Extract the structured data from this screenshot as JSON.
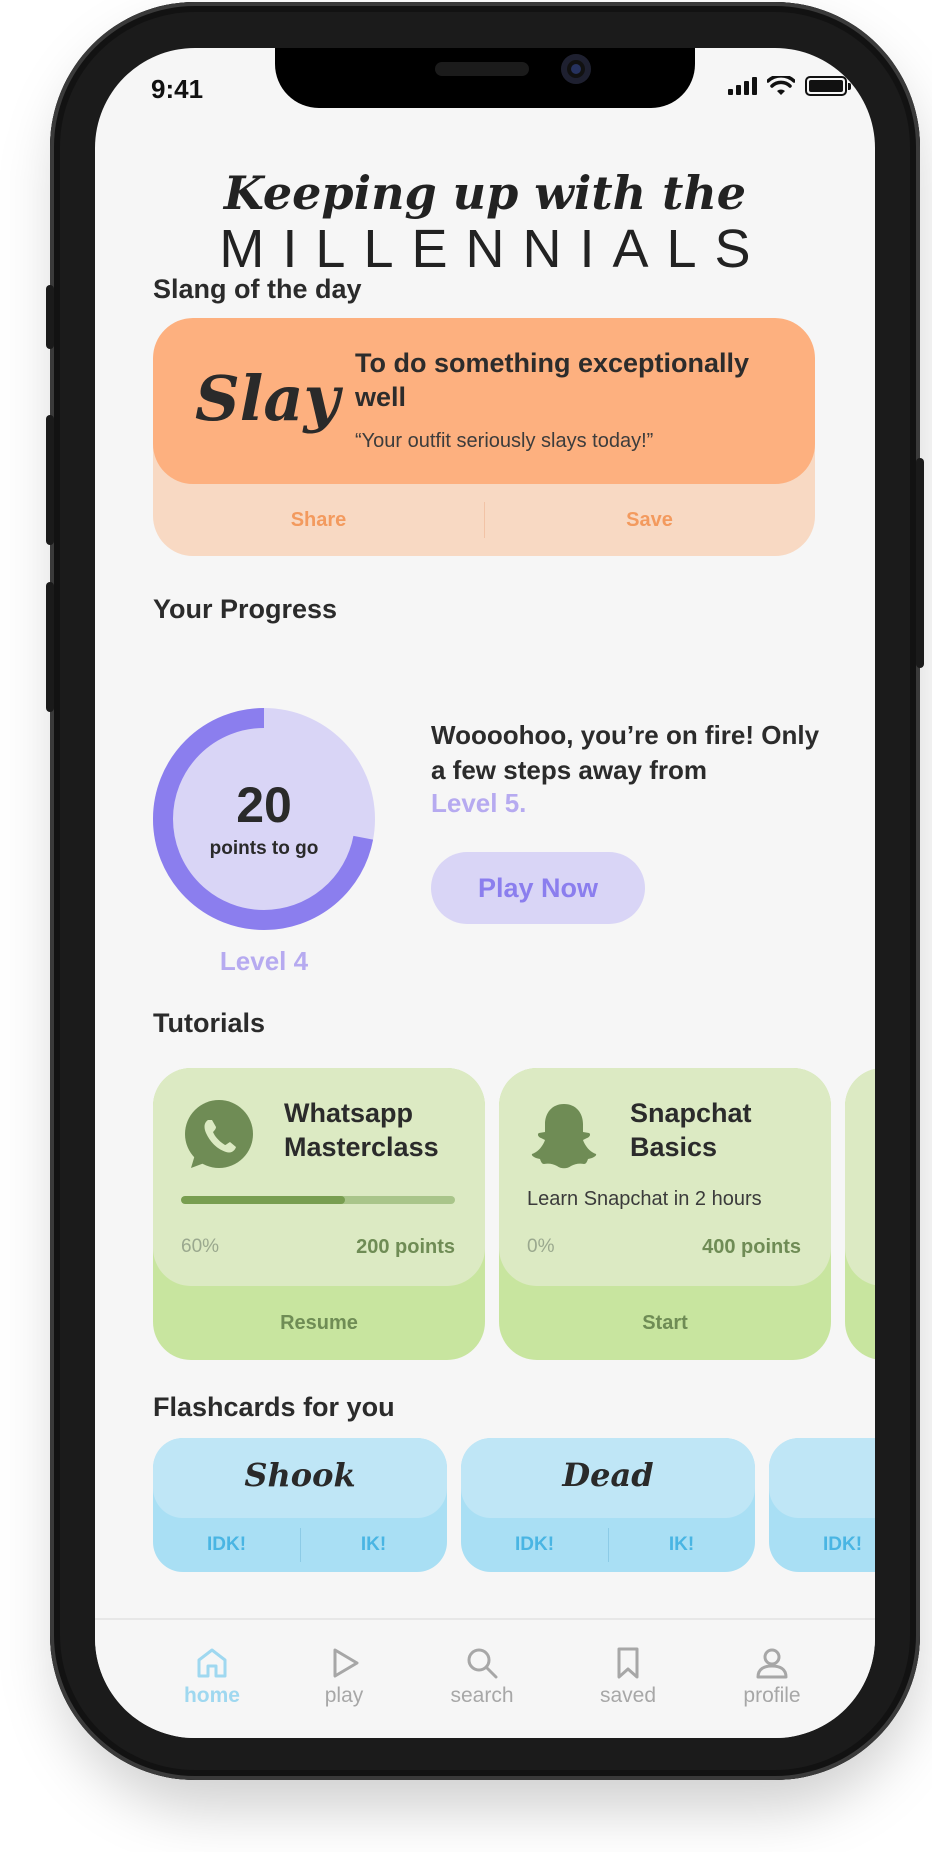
{
  "status": {
    "time": "9:41"
  },
  "brand": {
    "line1": "Keeping up with the",
    "line2": "MILLENNIALS"
  },
  "slang": {
    "section_title": "Slang of the day",
    "word": "Slay",
    "definition": "To do something exceptionally well",
    "example": "“Your outfit seriously slays today!”",
    "share_label": "Share",
    "save_label": "Save"
  },
  "progress": {
    "section_title": "Your Progress",
    "points": "20",
    "points_label": "points to go",
    "current_level": "Level 4",
    "message": "Woooohoo, you’re on fire! Only a few steps away from",
    "next_level": "Level 5.",
    "play_label": "Play Now",
    "ring_fraction": 0.28
  },
  "tutorials": {
    "section_title": "Tutorials",
    "items": [
      {
        "title": "Whatsapp Masterclass",
        "progress": "60%",
        "progress_value": 0.6,
        "points": "200 points",
        "action": "Resume",
        "icon": "whatsapp-icon"
      },
      {
        "title": "Snapchat Basics",
        "description": "Learn Snapchat in 2 hours",
        "progress": "0%",
        "points": "400 points",
        "action": "Start",
        "icon": "snapchat-icon"
      }
    ]
  },
  "flashcards": {
    "section_title": "Flashcards for you",
    "items": [
      {
        "word": "Shook",
        "idk": "IDK!",
        "ik": "IK!"
      },
      {
        "word": "Dead",
        "idk": "IDK!",
        "ik": "IK!"
      },
      {
        "idk": "IDK!"
      }
    ]
  },
  "nav": {
    "items": [
      {
        "label": "home",
        "icon": "home-icon",
        "active": true
      },
      {
        "label": "play",
        "icon": "play-icon"
      },
      {
        "label": "search",
        "icon": "search-icon"
      },
      {
        "label": "saved",
        "icon": "bookmark-icon"
      },
      {
        "label": "profile",
        "icon": "profile-icon"
      }
    ]
  },
  "colors": {
    "slang_accent": "#fdb07f",
    "progress_accent": "#8b7eee",
    "tutorial_accent": "#c8e59f",
    "flashcard_accent": "#a9dff4",
    "nav_active": "#9fd8f0"
  }
}
